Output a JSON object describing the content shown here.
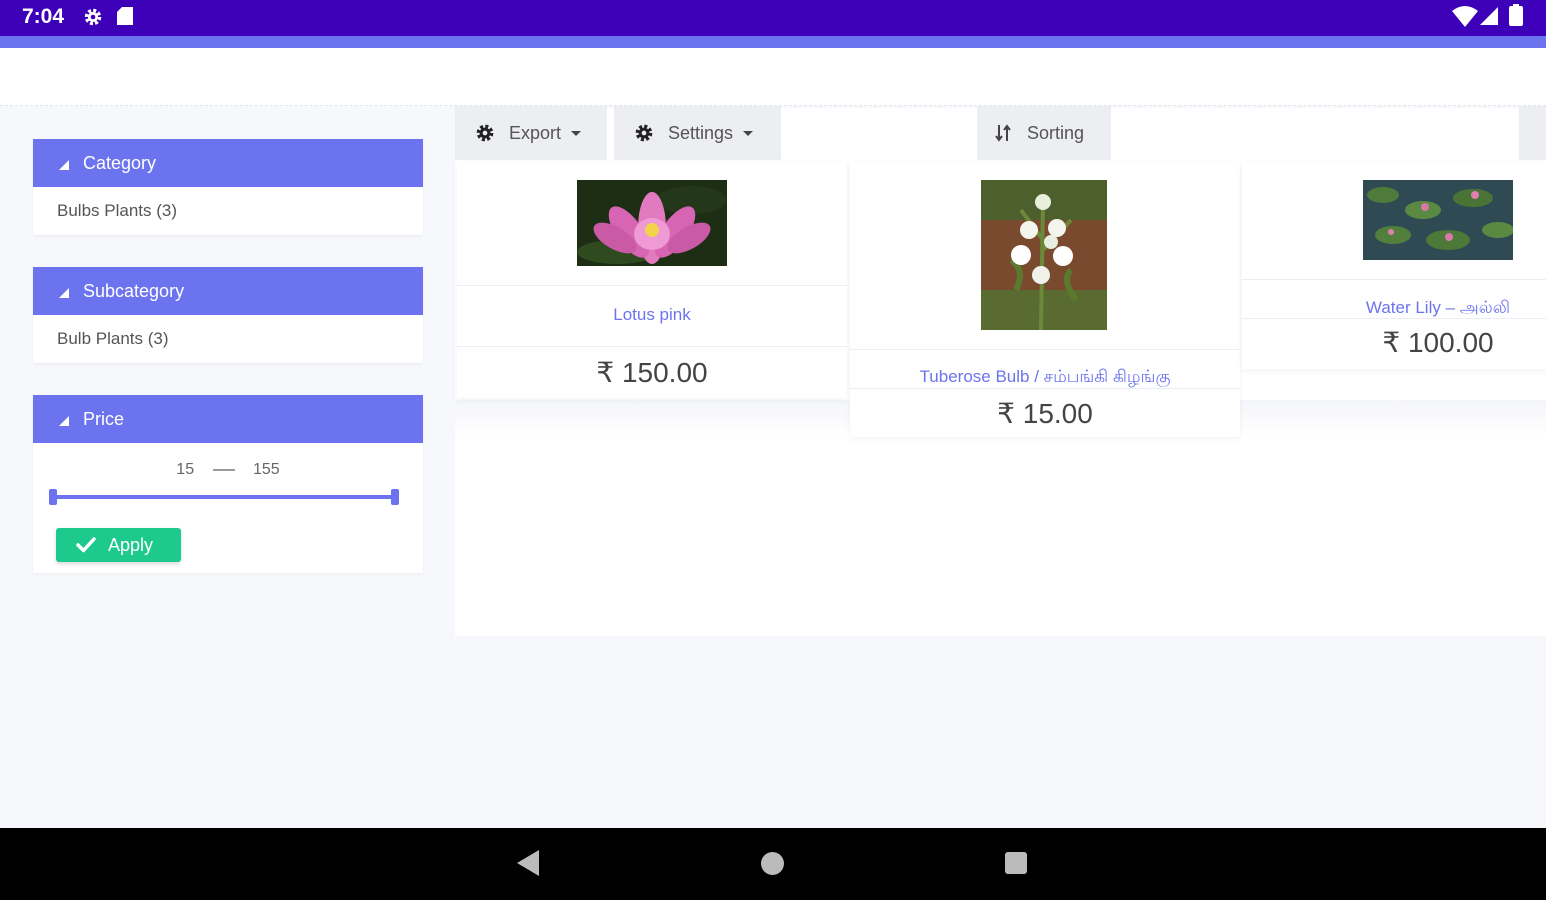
{
  "status_bar": {
    "time": "7:04",
    "icons": [
      "gear-icon",
      "sd-card-icon",
      "wifi-icon",
      "signal-icon",
      "battery-icon"
    ],
    "background": "#3d00b8"
  },
  "filters": {
    "category": {
      "title": "Category",
      "item": "Bulbs Plants (3)"
    },
    "subcategory": {
      "title": "Subcategory",
      "item": "Bulb Plants (3)"
    },
    "price": {
      "title": "Price",
      "min": "15",
      "max": "155",
      "apply_label": "Apply"
    }
  },
  "toolbar": {
    "export_label": "Export",
    "settings_label": "Settings",
    "sorting_label": "Sorting"
  },
  "products": [
    {
      "name": "Lotus pink",
      "price": "₹ 150.00"
    },
    {
      "name": "Tuberose Bulb / சம்பங்கி கிழங்கு",
      "price": "₹ 15.00"
    },
    {
      "name": "Water Lily – அல்லி",
      "price": "₹ 100.00"
    }
  ],
  "colors": {
    "accent": "#6b74ee",
    "apply": "#1dc98d",
    "status_bar": "#3d00b8"
  }
}
